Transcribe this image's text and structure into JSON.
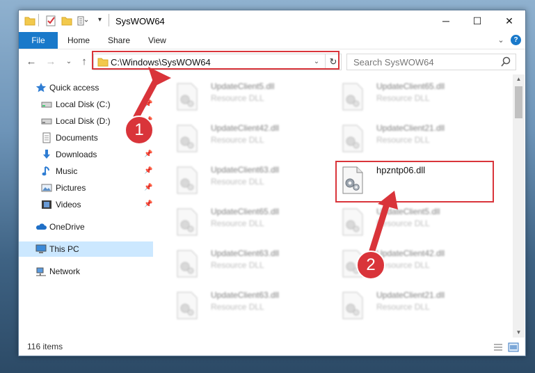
{
  "window": {
    "title": "SysWOW64",
    "controls": {
      "minimize": "─",
      "maximize": "☐",
      "close": "✕"
    }
  },
  "ribbon": {
    "tabs": [
      "File",
      "Home",
      "Share",
      "View"
    ],
    "help": "?"
  },
  "address": {
    "path": "C:\\Windows\\SysWOW64",
    "search_placeholder": "Search SysWOW64"
  },
  "sidebar": {
    "items": [
      {
        "label": "Quick access",
        "icon": "star-icon"
      },
      {
        "label": "Local Disk (C:)",
        "icon": "drive-icon",
        "pinned": true
      },
      {
        "label": "Local Disk (D:)",
        "icon": "drive-icon",
        "pinned": true
      },
      {
        "label": "Documents",
        "icon": "documents-icon",
        "pinned": true
      },
      {
        "label": "Downloads",
        "icon": "downloads-icon",
        "pinned": true
      },
      {
        "label": "Music",
        "icon": "music-icon",
        "pinned": true
      },
      {
        "label": "Pictures",
        "icon": "pictures-icon",
        "pinned": true
      },
      {
        "label": "Videos",
        "icon": "videos-icon",
        "pinned": true
      },
      {
        "label": "OneDrive",
        "icon": "onedrive-icon"
      },
      {
        "label": "This PC",
        "icon": "computer-icon",
        "selected": true
      },
      {
        "label": "Network",
        "icon": "network-icon"
      }
    ]
  },
  "files": {
    "left": [
      {
        "name": "UpdateClient5.dll",
        "type": "Resource DLL"
      },
      {
        "name": "UpdateClient42.dll",
        "type": "Resource DLL"
      },
      {
        "name": "UpdateClient63.dll",
        "type": "Resource DLL"
      },
      {
        "name": "UpdateClient65.dll",
        "type": "Resource DLL"
      },
      {
        "name": "UpdateClient63.dll",
        "type": "Resource DLL"
      },
      {
        "name": "UpdateClient63.dll",
        "type": "Resource DLL"
      }
    ],
    "right": [
      {
        "name": "UpdateClient65.dll",
        "type": "Resource DLL"
      },
      {
        "name": "UpdateClient21.dll",
        "type": "Resource DLL"
      },
      {
        "name": "hpzntp06.dll",
        "type": "",
        "highlighted": true
      },
      {
        "name": "UpdateClient5.dll",
        "type": "Resource DLL"
      },
      {
        "name": "UpdateClient42.dll",
        "type": "Resource DLL"
      },
      {
        "name": "UpdateClient21.dll",
        "type": "Resource DLL"
      }
    ]
  },
  "status": {
    "item_count": "116 items"
  },
  "annotations": {
    "step1": "1",
    "step2": "2"
  },
  "colors": {
    "accent": "#1979ca",
    "annotation_red": "#d9343a",
    "selected": "#cce8ff"
  }
}
